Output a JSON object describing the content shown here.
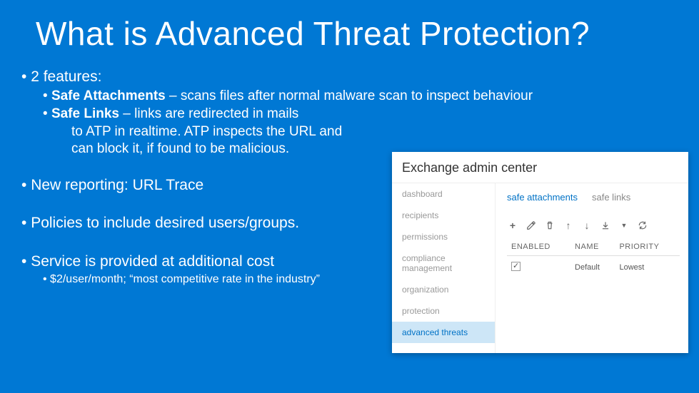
{
  "title": "What is Advanced Threat Protection?",
  "bullets": {
    "features_label": "2 features:",
    "safe_attach_bold": "Safe Attachments",
    "safe_attach_rest": " – scans files after normal malware scan to inspect behaviour",
    "safe_links_bold": "Safe Links",
    "safe_links_rest": " – links are redirected in mails",
    "safe_links_line2": "to ATP in realtime. ATP inspects the URL and",
    "safe_links_line3": "can block it, if found to be malicious.",
    "reporting": "New reporting: URL Trace",
    "policies": "Policies to include desired users/groups.",
    "cost": "Service is provided at additional cost",
    "cost_sub": "$2/user/month; “most competitive rate in the industry”"
  },
  "panel": {
    "title": "Exchange admin center",
    "nav": {
      "dashboard": "dashboard",
      "recipients": "recipients",
      "permissions": "permissions",
      "compliance": "compliance management",
      "organization": "organization",
      "protection": "protection",
      "advanced": "advanced threats"
    },
    "tabs": {
      "safe_attachments": "safe attachments",
      "safe_links": "safe links"
    },
    "table": {
      "col_enabled": "ENABLED",
      "col_name": "NAME",
      "col_priority": "PRIORITY",
      "row1_name": "Default",
      "row1_priority": "Lowest"
    }
  }
}
